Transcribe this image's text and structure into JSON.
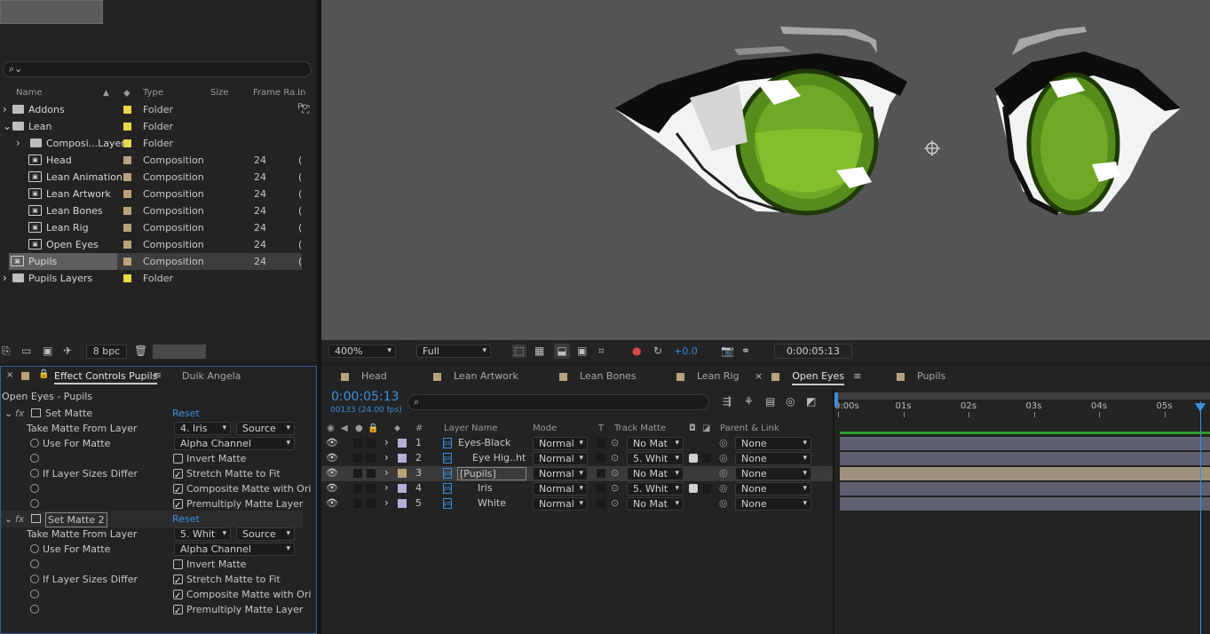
{
  "project": {
    "search_placeholder": "",
    "columns": [
      "Name",
      "Type",
      "Size",
      "Frame Ra...",
      "In Po"
    ],
    "items": [
      {
        "name": "Addons",
        "type": "Folder",
        "fps": "",
        "color": "#e8d84a",
        "indent": 0,
        "expand": "›",
        "icon": "folder-icon"
      },
      {
        "name": "Lean",
        "type": "Folder",
        "fps": "",
        "color": "#e8d84a",
        "indent": 0,
        "expand": "⌄",
        "icon": "folder-icon"
      },
      {
        "name": "Composi...Layers",
        "type": "Folder",
        "fps": "",
        "color": "#e8d84a",
        "indent": 1,
        "expand": "›",
        "icon": "folder-icon"
      },
      {
        "name": "Head",
        "type": "Composition",
        "fps": "24",
        "color": "#b9a27b",
        "indent": 1,
        "expand": "",
        "icon": "composition-icon"
      },
      {
        "name": "Lean Animation",
        "type": "Composition",
        "fps": "24",
        "color": "#b9a27b",
        "indent": 1,
        "expand": "",
        "icon": "composition-icon"
      },
      {
        "name": "Lean Artwork",
        "type": "Composition",
        "fps": "24",
        "color": "#b9a27b",
        "indent": 1,
        "expand": "",
        "icon": "composition-icon"
      },
      {
        "name": "Lean Bones",
        "type": "Composition",
        "fps": "24",
        "color": "#b9a27b",
        "indent": 1,
        "expand": "",
        "icon": "composition-icon"
      },
      {
        "name": "Lean Rig",
        "type": "Composition",
        "fps": "24",
        "color": "#b9a27b",
        "indent": 1,
        "expand": "",
        "icon": "composition-icon"
      },
      {
        "name": "Open Eyes",
        "type": "Composition",
        "fps": "24",
        "color": "#b9a27b",
        "indent": 1,
        "expand": "",
        "icon": "composition-icon"
      },
      {
        "name": "Pupils",
        "type": "Composition",
        "fps": "24",
        "color": "#b9a27b",
        "indent": 0,
        "expand": "",
        "icon": "composition-icon",
        "selected": true
      },
      {
        "name": "Pupils Layers",
        "type": "Folder",
        "fps": "",
        "color": "#e8d84a",
        "indent": 0,
        "expand": "›",
        "icon": "folder-icon"
      }
    ],
    "bpc_label": "8 bpc"
  },
  "effect_controls": {
    "tab_label": "Effect Controls Pupils",
    "other_tab": "Duik Angela",
    "subtitle": "Open Eyes - Pupils",
    "effects": [
      {
        "name": "Set Matte",
        "reset": "Reset",
        "take_matte_label": "Take Matte From Layer",
        "take_matte_value": "4. Iris",
        "source_value": "Source",
        "use_for_matte_label": "Use For Matte",
        "use_for_matte_value": "Alpha Channel",
        "invert_label": "Invert Matte",
        "sizes_label": "If Layer Sizes Differ",
        "stretch_label": "Stretch Matte to Fit",
        "composite_label": "Composite Matte with Ori",
        "premultiply_label": "Premultiply Matte Layer"
      },
      {
        "name": "Set Matte 2",
        "reset": "Reset",
        "take_matte_label": "Take Matte From Layer",
        "take_matte_value": "5. Whit",
        "source_value": "Source",
        "use_for_matte_label": "Use For Matte",
        "use_for_matte_value": "Alpha Channel",
        "invert_label": "Invert Matte",
        "sizes_label": "If Layer Sizes Differ",
        "stretch_label": "Stretch Matte to Fit",
        "composite_label": "Composite Matte with Ori",
        "premultiply_label": "Premultiply Matte Layer"
      }
    ]
  },
  "viewer": {
    "zoom": "400%",
    "resolution": "Full",
    "exposure": "+0.0",
    "timecode": "0:00:05:13"
  },
  "timeline": {
    "tabs": [
      "Head",
      "Lean Artwork",
      "Lean Bones",
      "Lean Rig",
      "Open Eyes",
      "Pupils"
    ],
    "active_tab": "Open Eyes",
    "timecode": "0:00:05:13",
    "frame_info": "00133 (24.00 fps)",
    "columns": {
      "num": "#",
      "layer_name": "Layer Name",
      "mode": "Mode",
      "t": "T",
      "track_matte": "Track Matte",
      "parent": "Parent & Link"
    },
    "ruler": [
      "0:00s",
      "01s",
      "02s",
      "03s",
      "04s",
      "05s"
    ],
    "layers": [
      {
        "num": "1",
        "name": "Eyes-Black",
        "mode": "Normal",
        "matte": "No Mat",
        "parent": "None",
        "color": "#b3b0d6",
        "bar": "#5f5f72"
      },
      {
        "num": "2",
        "name": "Eye Hig..ht",
        "mode": "Normal",
        "matte": "5. Whit",
        "parent": "None",
        "color": "#b3b0d6",
        "bar": "#5f5f72"
      },
      {
        "num": "3",
        "name": "[Pupils]",
        "mode": "Normal",
        "matte": "No Mat",
        "parent": "None",
        "color": "#b9a27b",
        "bar": "#9d937c",
        "selected": true
      },
      {
        "num": "4",
        "name": "Iris",
        "mode": "Normal",
        "matte": "5. Whit",
        "parent": "None",
        "color": "#b3b0d6",
        "bar": "#5f5f72"
      },
      {
        "num": "5",
        "name": "White",
        "mode": "Normal",
        "matte": "No Mat",
        "parent": "None",
        "color": "#b3b0d6",
        "bar": "#5f5f72"
      }
    ]
  }
}
